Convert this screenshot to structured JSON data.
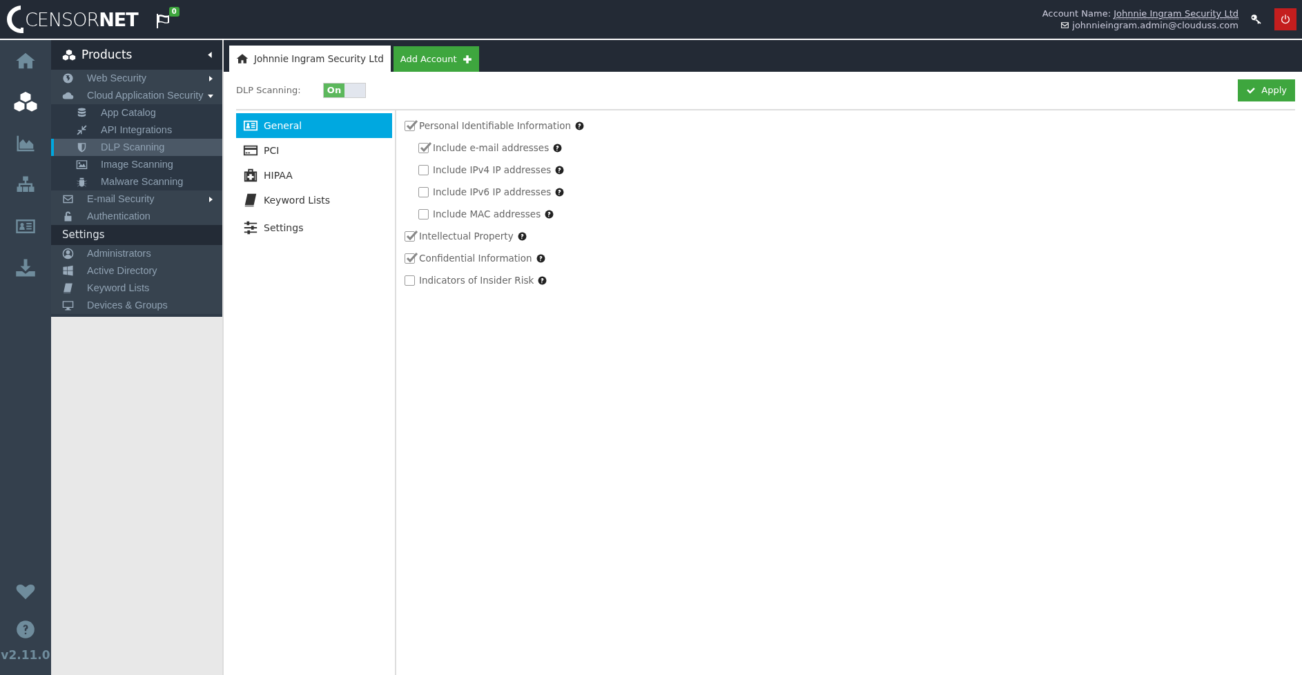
{
  "header": {
    "logo": "CENSOR**NET**",
    "notification_count": "0",
    "account_label": "Account Name:",
    "account_name": "Johnnie Ingram Security Ltd",
    "email": "johnnieingram.admin@clouduss.com"
  },
  "rail": {
    "items": [
      {
        "selected": false
      },
      {
        "selected": true
      },
      {
        "selected": false
      },
      {
        "selected": false
      },
      {
        "selected": false
      },
      {
        "selected": false
      }
    ],
    "version": "v2.11.0"
  },
  "sidebar": {
    "title": "Products",
    "sections": [
      {
        "kind": "group",
        "items": [
          {
            "label": "Web Security",
            "expanded": false,
            "selected": false
          },
          {
            "label": "Cloud Application Security",
            "expanded": true,
            "selected": false,
            "children": [
              {
                "label": "App Catalog",
                "selected": false
              },
              {
                "label": "API Integrations",
                "selected": false
              },
              {
                "label": "DLP Scanning",
                "selected": true
              },
              {
                "label": "Image Scanning",
                "selected": false
              },
              {
                "label": "Malware Scanning",
                "selected": false
              }
            ]
          },
          {
            "label": "E-mail Security",
            "expanded": false,
            "selected": false
          },
          {
            "label": "Authentication",
            "selected": false
          }
        ]
      },
      {
        "kind": "heading",
        "label": "Settings",
        "items": [
          {
            "label": "Administrators",
            "selected": false
          },
          {
            "label": "Active Directory",
            "selected": false
          },
          {
            "label": "Keyword Lists",
            "selected": false
          },
          {
            "label": "Devices & Groups",
            "selected": false
          }
        ]
      }
    ]
  },
  "tabs": [
    {
      "label": "Johnnie Ingram Security Ltd",
      "selected": true
    }
  ],
  "add_button": "Add Account",
  "dlp": {
    "label": "DLP Scanning:",
    "on": true,
    "state_text": "On"
  },
  "apply_button": "Apply",
  "menu": [
    {
      "label": "General",
      "selected": true
    },
    {
      "label": "PCI",
      "selected": false
    },
    {
      "label": "HIPAA",
      "selected": false
    },
    {
      "label": "Keyword Lists",
      "selected": false
    },
    {
      "label": "Settings",
      "selected": false
    }
  ],
  "options": [
    {
      "label": "Personal Identifiable Information",
      "checked": true,
      "children": [
        {
          "label": "Include e-mail addresses",
          "checked": true
        },
        {
          "label": "Include IPv4 IP addresses",
          "checked": false
        },
        {
          "label": "Include IPv6 IP addresses",
          "checked": false
        },
        {
          "label": "Include MAC addresses",
          "checked": false
        }
      ]
    },
    {
      "label": "Intellectual Property",
      "checked": true
    },
    {
      "label": "Confidential Information",
      "checked": true
    },
    {
      "label": "Indicators of Insider Risk",
      "checked": false
    }
  ]
}
